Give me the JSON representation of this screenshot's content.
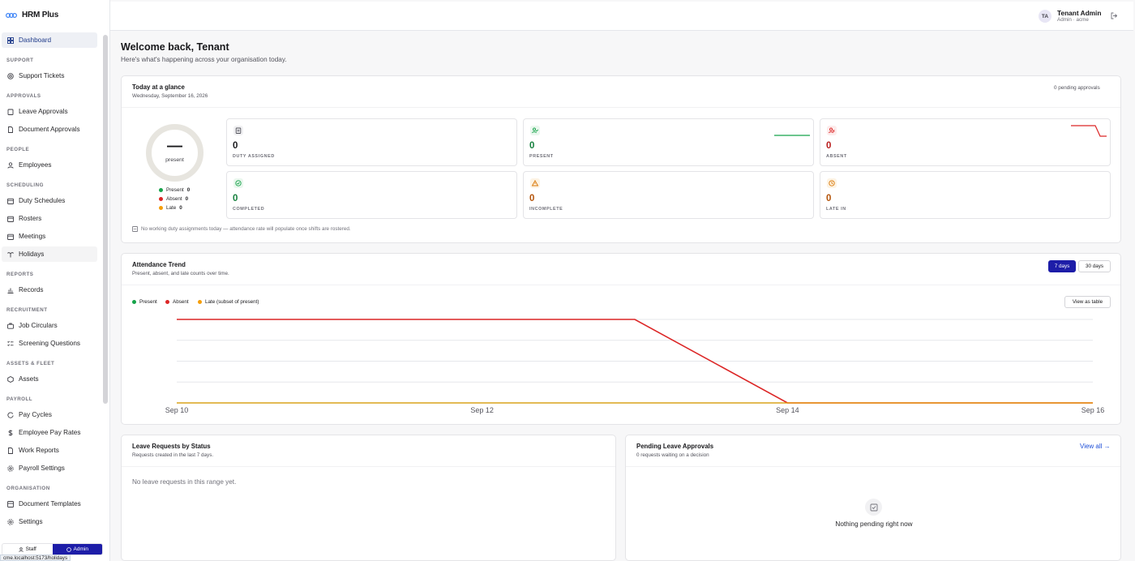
{
  "app": {
    "name": "HRM Plus"
  },
  "sidebar": {
    "dashboard": "Dashboard",
    "sections": {
      "support": "SUPPORT",
      "approvals": "APPROVALS",
      "people": "PEOPLE",
      "scheduling": "SCHEDULING",
      "reports": "REPORTS",
      "recruitment": "RECRUITMENT",
      "assets": "ASSETS & FLEET",
      "payroll": "PAYROLL",
      "organisation": "ORGANISATION"
    },
    "items": {
      "support_tickets": "Support Tickets",
      "leave_approvals": "Leave Approvals",
      "document_approvals": "Document Approvals",
      "employees": "Employees",
      "duty_schedules": "Duty Schedules",
      "rosters": "Rosters",
      "meetings": "Meetings",
      "holidays": "Holidays",
      "records": "Records",
      "job_circulars": "Job Circulars",
      "screening_questions": "Screening Questions",
      "assets": "Assets",
      "pay_cycles": "Pay Cycles",
      "employee_pay_rates": "Employee Pay Rates",
      "work_reports": "Work Reports",
      "payroll_settings": "Payroll Settings",
      "document_templates": "Document Templates",
      "settings": "Settings"
    },
    "role_switch": {
      "staff": "Staff",
      "admin": "Admin"
    },
    "status_url": "cme.localhost:5173/holidays"
  },
  "header": {
    "initials": "TA",
    "name": "Tenant Admin",
    "role": "Admin · acme"
  },
  "welcome": {
    "title": "Welcome back, Tenant",
    "subtitle": "Here's what's happening across your organisation today."
  },
  "glance": {
    "title": "Today at a glance",
    "date": "Wednesday, September 16, 2026",
    "pending": "0 pending approvals",
    "donut_value": "—",
    "donut_label": "present",
    "legend": [
      {
        "label": "Present",
        "value": "0",
        "color": "#16a34a"
      },
      {
        "label": "Absent",
        "value": "0",
        "color": "#dc2626"
      },
      {
        "label": "Late",
        "value": "0",
        "color": "#f59e0b"
      }
    ],
    "stats": {
      "duty": {
        "value": "0",
        "label": "DUTY ASSIGNED"
      },
      "present": {
        "value": "0",
        "label": "PRESENT"
      },
      "absent": {
        "value": "0",
        "label": "ABSENT"
      },
      "completed": {
        "value": "0",
        "label": "COMPLETED"
      },
      "incomplete": {
        "value": "0",
        "label": "INCOMPLETE"
      },
      "late": {
        "value": "0",
        "label": "LATE IN"
      }
    },
    "note": "No working duty assignments today — attendance rate will populate once shifts are rostered."
  },
  "trend": {
    "title": "Attendance Trend",
    "subtitle": "Present, absent, and late counts over time.",
    "range_7": "7 days",
    "range_30": "30 days",
    "view_table": "View as table",
    "colors": {
      "present": "#16a34a",
      "absent": "#dc2626",
      "late": "#f59e0b"
    }
  },
  "chart_data": {
    "type": "line",
    "x": [
      "Sep 10",
      "Sep 11",
      "Sep 12",
      "Sep 13",
      "Sep 14",
      "Sep 15",
      "Sep 16"
    ],
    "tick_labels": [
      "Sep 10",
      "Sep 12",
      "Sep 14",
      "Sep 16"
    ],
    "series": [
      {
        "name": "Present",
        "values": [
          0,
          0,
          0,
          0,
          0,
          0,
          0
        ]
      },
      {
        "name": "Absent",
        "values": [
          4,
          4,
          4,
          4,
          0,
          0,
          0
        ]
      },
      {
        "name": "Late (subset of present)",
        "values": [
          0,
          0,
          0,
          0,
          0,
          0,
          0
        ]
      }
    ],
    "ylim": [
      0,
      4
    ],
    "grid": true,
    "legend": "top-left"
  },
  "leave_status": {
    "title": "Leave Requests by Status",
    "subtitle": "Requests created in the last 7 days.",
    "empty": "No leave requests in this range yet."
  },
  "pending_leave": {
    "title": "Pending Leave Approvals",
    "subtitle": "0 requests waiting on a decision",
    "view_all": "View all →",
    "empty": "Nothing pending right now"
  }
}
